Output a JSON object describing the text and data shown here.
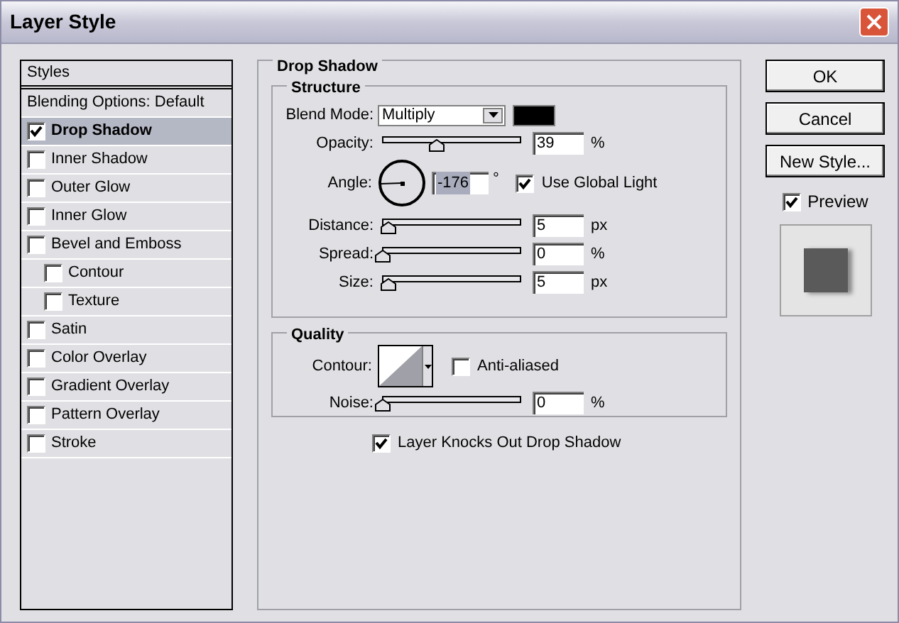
{
  "window": {
    "title": "Layer Style"
  },
  "styles_list": {
    "header": "Styles",
    "items": [
      {
        "label": "Blending Options: Default",
        "kind": "option",
        "selected": false
      },
      {
        "label": "Drop Shadow",
        "kind": "effect",
        "checked": true,
        "selected": true
      },
      {
        "label": "Inner Shadow",
        "kind": "effect",
        "checked": false,
        "selected": false
      },
      {
        "label": "Outer Glow",
        "kind": "effect",
        "checked": false,
        "selected": false
      },
      {
        "label": "Inner Glow",
        "kind": "effect",
        "checked": false,
        "selected": false
      },
      {
        "label": "Bevel and Emboss",
        "kind": "effect",
        "checked": false,
        "selected": false,
        "children": [
          {
            "label": "Contour",
            "kind": "effect",
            "checked": false,
            "selected": false
          },
          {
            "label": "Texture",
            "kind": "effect",
            "checked": false,
            "selected": false
          }
        ]
      },
      {
        "label": "Satin",
        "kind": "effect",
        "checked": false,
        "selected": false
      },
      {
        "label": "Color Overlay",
        "kind": "effect",
        "checked": false,
        "selected": false
      },
      {
        "label": "Gradient Overlay",
        "kind": "effect",
        "checked": false,
        "selected": false
      },
      {
        "label": "Pattern Overlay",
        "kind": "effect",
        "checked": false,
        "selected": false
      },
      {
        "label": "Stroke",
        "kind": "effect",
        "checked": false,
        "selected": false
      }
    ]
  },
  "panel": {
    "title": "Drop Shadow",
    "structure": {
      "title": "Structure",
      "blend_mode": {
        "label": "Blend Mode:",
        "value": "Multiply",
        "color": "#000000"
      },
      "opacity": {
        "label": "Opacity:",
        "level": 0.39,
        "value": "39",
        "unit": "%"
      },
      "angle": {
        "label": "Angle:",
        "value": "-176",
        "unit": "°"
      },
      "use_global_light": {
        "label": "Use Global Light",
        "checked": true
      },
      "sliders": [
        {
          "label": "Distance:",
          "level": 0.04,
          "value": "5",
          "unit": "px"
        },
        {
          "label": "Spread:",
          "level": 0,
          "value": "0",
          "unit": "%"
        },
        {
          "label": "Size:",
          "level": 0.04,
          "value": "5",
          "unit": "px"
        }
      ]
    },
    "quality": {
      "title": "Quality",
      "contour": {
        "label": "Contour:"
      },
      "anti_aliased": {
        "label": "Anti-aliased",
        "checked": false
      },
      "noise": {
        "label": "Noise:",
        "level": 0,
        "value": "0",
        "unit": "%"
      }
    },
    "knockout": {
      "label": "Layer Knocks Out Drop Shadow",
      "checked": true
    }
  },
  "buttons": [
    "OK",
    "Cancel",
    "New Style..."
  ],
  "preview": {
    "label": "Preview",
    "checked": true
  }
}
